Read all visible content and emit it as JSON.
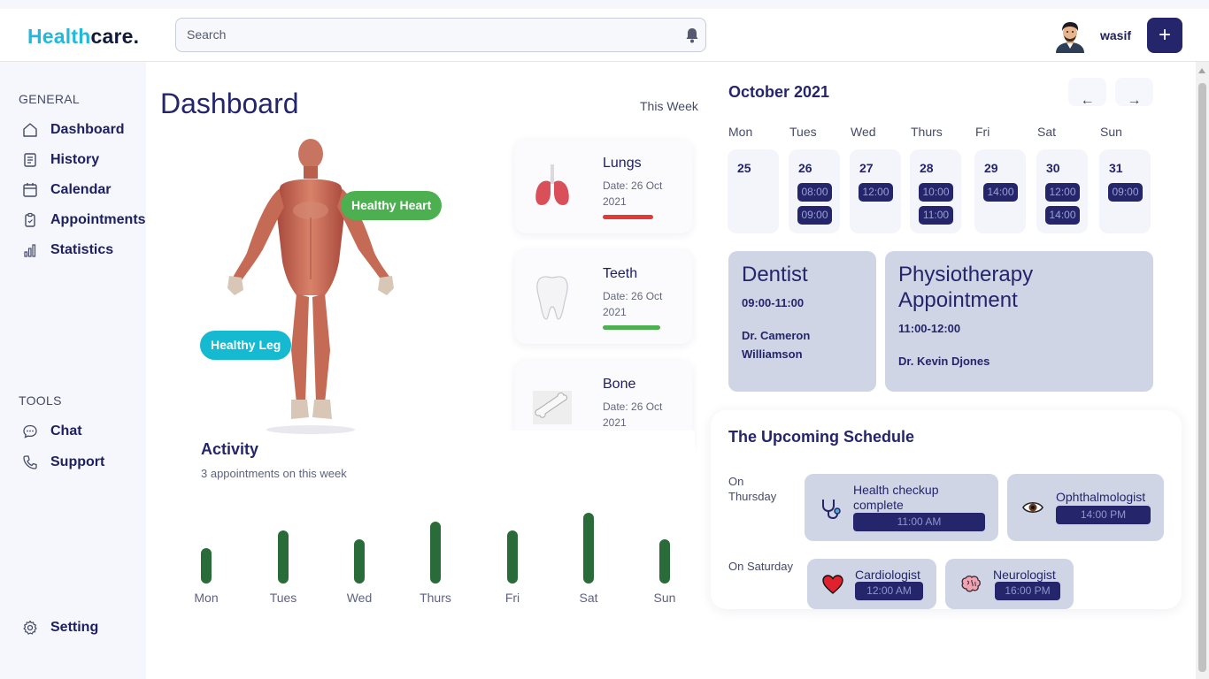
{
  "header": {
    "logo_part1": "Health",
    "logo_part2": "care.",
    "search_placeholder": "Search",
    "username": "wasif",
    "add_label": "+"
  },
  "sidebar": {
    "general_label": "GENERAL",
    "tools_label": "TOOLS",
    "items": [
      {
        "label": "Dashboard",
        "icon": "home-icon"
      },
      {
        "label": "History",
        "icon": "history-icon"
      },
      {
        "label": "Calendar",
        "icon": "calendar-icon"
      },
      {
        "label": "Appointments",
        "icon": "clipboard-icon"
      },
      {
        "label": "Statistics",
        "icon": "bar-chart-icon"
      }
    ],
    "tools": [
      {
        "label": "Chat",
        "icon": "chat-icon"
      },
      {
        "label": "Support",
        "icon": "phone-icon"
      }
    ],
    "setting_label": "Setting"
  },
  "dashboard": {
    "title": "Dashboard",
    "period": "This Week",
    "tags": {
      "heart": "Healthy Heart",
      "leg": "Healthy Leg"
    },
    "organs": [
      {
        "name": "Lungs",
        "date": "Date: 26 Oct 2021",
        "status_color": "#e53935",
        "level": 0.5
      },
      {
        "name": "Teeth",
        "date": "Date: 26 Oct 2021",
        "status_color": "#4caf50",
        "level": 0.58
      },
      {
        "name": "Bone",
        "date": "Date: 26 Oct 2021"
      }
    ]
  },
  "activity": {
    "title": "Activity",
    "subtitle": "3 appointments on this week"
  },
  "chart_data": {
    "type": "bar",
    "categories": [
      "Mon",
      "Tues",
      "Wed",
      "Thurs",
      "Fri",
      "Sat",
      "Sun"
    ],
    "values": [
      40,
      60,
      50,
      70,
      60,
      80,
      50
    ],
    "ylim": [
      0,
      80
    ]
  },
  "calendar": {
    "month": "October 2021",
    "prev": "←",
    "next": "→",
    "dow": [
      "Mon",
      "Tues",
      "Wed",
      "Thurs",
      "Fri",
      "Sat",
      "Sun"
    ],
    "days": [
      {
        "d": "25",
        "slots": []
      },
      {
        "d": "26",
        "slots": [
          "08:00",
          "09:00"
        ]
      },
      {
        "d": "27",
        "slots": [
          "12:00"
        ]
      },
      {
        "d": "28",
        "slots": [
          "10:00",
          "11:00"
        ]
      },
      {
        "d": "29",
        "slots": [
          "14:00"
        ]
      },
      {
        "d": "30",
        "slots": [
          "12:00",
          "14:00"
        ]
      },
      {
        "d": "31",
        "slots": [
          "09:00"
        ]
      }
    ]
  },
  "appointments": [
    {
      "title": "Dentist",
      "time": "09:00-11:00",
      "doctor": "Dr. Cameron Williamson"
    },
    {
      "title": "Physiotherapy Appointment",
      "time": "11:00-12:00",
      "doctor": "Dr. Kevin Djones"
    }
  ],
  "upcoming": {
    "title": "The Upcoming Schedule",
    "groups": [
      {
        "label": "On Thursday",
        "items": [
          {
            "name": "Health checkup complete",
            "time": "11:00 AM",
            "icon": "stethoscope-icon"
          },
          {
            "name": "Ophthalmologist",
            "time": "14:00 PM",
            "icon": "eye-icon"
          }
        ]
      },
      {
        "label": "On Saturday",
        "items": [
          {
            "name": "Cardiologist",
            "time": "12:00 AM",
            "icon": "heart-icon"
          },
          {
            "name": "Neurologist",
            "time": "16:00 PM",
            "icon": "brain-icon"
          }
        ]
      }
    ]
  }
}
